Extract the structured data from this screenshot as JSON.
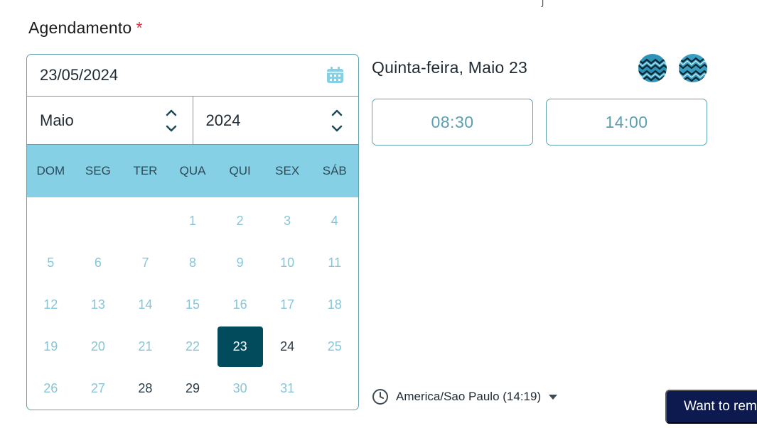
{
  "top_mark": "ʃ",
  "field": {
    "label": "Agendamento",
    "required_mark": "*"
  },
  "date_input": {
    "value": "23/05/2024",
    "icon": "calendar-icon"
  },
  "month_select": {
    "value": "Maio",
    "icon": "chevron-up-down-icon"
  },
  "year_select": {
    "value": "2024",
    "icon": "chevron-up-down-icon"
  },
  "weekdays": [
    "DOM",
    "SEG",
    "TER",
    "QUA",
    "QUI",
    "SEX",
    "SÁB"
  ],
  "weeks": [
    [
      "",
      "",
      "",
      "1",
      "2",
      "3",
      "4"
    ],
    [
      "5",
      "6",
      "7",
      "8",
      "9",
      "10",
      "11"
    ],
    [
      "12",
      "13",
      "14",
      "15",
      "16",
      "17",
      "18"
    ],
    [
      "19",
      "20",
      "21",
      "22",
      "23",
      "24",
      "25"
    ],
    [
      "26",
      "27",
      "28",
      "29",
      "30",
      "31",
      ""
    ]
  ],
  "available_days": [
    "23",
    "24",
    "28",
    "29"
  ],
  "selected_day": "23",
  "day_heading": "Quinta-feira, Maio 23",
  "time_slots": [
    "08:30",
    "14:00"
  ],
  "timezone": {
    "label": "America/Sao Paulo (14:19)",
    "icon": "clock-icon",
    "caret_icon": "caret-down-icon"
  },
  "promo": {
    "label": "Want to rem"
  },
  "colors": {
    "accent": "#5fa3b2",
    "header_bg": "#85d0e4",
    "selected_bg": "#014b5c",
    "required": "#d0343b",
    "promo_bg": "#0c1a4f"
  }
}
